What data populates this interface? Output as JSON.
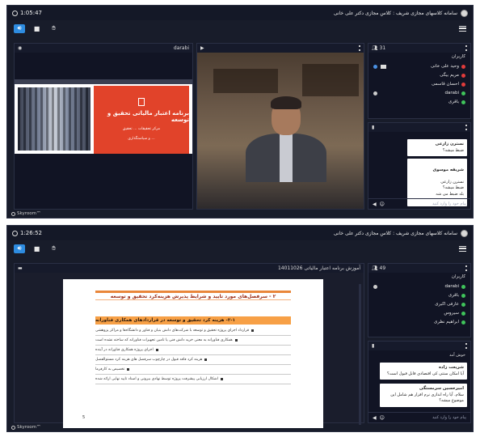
{
  "screens": [
    {
      "clock": "1:05:47",
      "app_title": "سامانه کلاسهای مجازی شریف : کلاس مجازی دکتر علی خانی",
      "footer": "Skyroom™",
      "share_panel": {
        "user": "darabi"
      },
      "slide": {
        "title": "برنامه اعتبار مالیاتی تحقیق و توسعه",
        "subtitle_1": "مرکز تحقیقات ... تحقیق",
        "subtitle_2": "... و سیاستگذاری"
      },
      "users": {
        "count": "31",
        "label": "کاربران",
        "items": [
          {
            "name": "وحید علی خانی",
            "status": "red"
          },
          {
            "name": "مریم بیگی",
            "status": "red"
          },
          {
            "name": "احسان قاسمی",
            "status": "red"
          },
          {
            "name": "darabi",
            "status": "green"
          },
          {
            "name": "باقری",
            "status": "green"
          }
        ]
      },
      "chat": {
        "messages": [
          {
            "who": "نسترن زارعی",
            "text": "ضبط میشه؟"
          },
          {
            "who": "شریفه موسوی",
            "text": "نسترن زارعی\nضبط میشه؟\nبله ضبط می شه"
          }
        ],
        "placeholder": "پیام خود را وارد کنید"
      }
    },
    {
      "clock": "1:26:52",
      "app_title": "سامانه کلاسهای مجازی شریف : کلاس مجازی دکتر علی خانی",
      "footer": "Skyroom™",
      "share_panel": {
        "title": "آموزش برنامه اعتبار مالیاتی 14011026"
      },
      "slide": {
        "heading": "۲ - سرفصل‌های مورد تایید و شرایط پذیرش هزینه‌کرد تحقیق و توسعه",
        "band": "۲-۱- هزینه کرد تحقیق و توسعه در قراردادهای همکاری فناورانه",
        "items": [
          "قرارداد اجرای پروژه تحقیق و توسعه با شرکت‌های دانش بنیان و فناور و دانشگاه‌ها و مراکز پژوهشی",
          "همکاری فناورانه به معنی خرید دانش فنی یا تامین تجهیزات فناورانه که ساخته نشده است",
          "اجرای پروژه همکاری فناورانه در آینده",
          "هزینه کرد فاقد قبول در چارچوب سرفصل های هزینه کرد مستوالفصل",
          "تخصیص به کارفرما",
          "اشکال ارزیابی پیشرفت پروژه توسط نهادی بیرونی و اسناد تایید نهایی ارائه شده"
        ],
        "page": "5"
      },
      "users": {
        "count": "49",
        "label": "کاربران",
        "items": [
          {
            "name": "darabi",
            "status": "green"
          },
          {
            "name": "باقری",
            "status": "green"
          },
          {
            "name": "عارفی اکبری",
            "status": "green"
          },
          {
            "name": "سیروس",
            "status": "green"
          },
          {
            "name": "ابراهیم نظری",
            "status": "green"
          }
        ]
      },
      "chat": {
        "top_line": "خوش آمد",
        "messages": [
          {
            "who": "شریعت زاده",
            "text": "آیا امکان ستتی کی اقتصادی قابل قبول است؟"
          },
          {
            "who": "امیرحسین سرمستگی",
            "text": "سلام. آیا راه اندازی نرم افزار هم شامل این موضوع میشه؟"
          }
        ],
        "placeholder": "پیام خود را وارد کنید"
      }
    }
  ],
  "icons": {
    "clock": "clock-icon",
    "speaker": "speaker-icon",
    "camera": "camera-icon",
    "hand": "hand-icon",
    "menu": "menu-icon",
    "send": "send-icon",
    "emoji": "emoji-icon"
  },
  "colors": {
    "bg": "#181c2a",
    "accent_blue": "#2e8ce0",
    "slide_red": "#e1432a",
    "slide_orange": "#f7a046"
  }
}
